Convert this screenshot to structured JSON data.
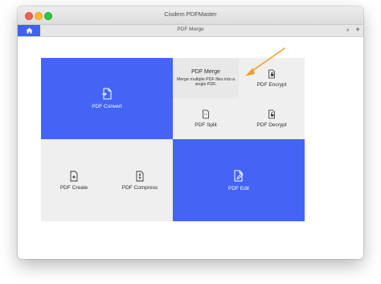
{
  "window": {
    "title": "Cisdem PDFMaster"
  },
  "tabs": {
    "home_icon": "home-icon",
    "active_tab_label": "PDF Merge",
    "close_glyph": "×",
    "add_glyph": "+"
  },
  "tiles": {
    "convert": {
      "label": "PDF Convert",
      "icon": "convert-document-icon"
    },
    "merge": {
      "label": "PDF Merge",
      "description": "Merge multiple PDF files into a single PDF.",
      "highlighted": true
    },
    "encrypt": {
      "label": "PDF Encrypt",
      "icon": "lock-document-icon"
    },
    "split": {
      "label": "PDF Split",
      "icon": "split-document-icon"
    },
    "decrypt": {
      "label": "PDF Decrypt",
      "icon": "unlock-document-icon"
    },
    "create": {
      "label": "PDF Create",
      "icon": "create-document-icon"
    },
    "compress": {
      "label": "PDF Compress",
      "icon": "compress-document-icon"
    },
    "edit": {
      "label": "PDF Edit",
      "icon": "edit-document-icon"
    }
  },
  "colors": {
    "accent_blue": "#4364f5",
    "tile_gray": "#efefef",
    "annotation_arrow": "#f39c2b"
  }
}
